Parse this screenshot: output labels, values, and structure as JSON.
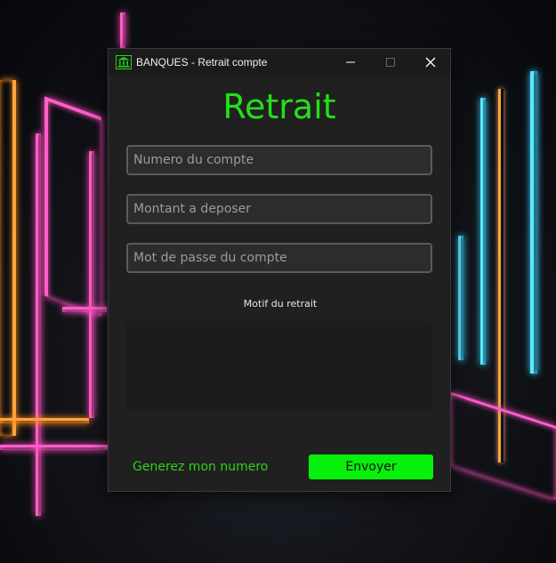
{
  "window": {
    "title": "BANQUES - Retrait compte",
    "icon": "bank-icon"
  },
  "form": {
    "heading": "Retrait",
    "account_number_placeholder": "Numero du compte",
    "amount_placeholder": "Montant a deposer",
    "password_placeholder": "Mot de passe du compte",
    "reason_label": "Motif du retrait",
    "reason_value": "",
    "generate_link": "Generez mon numero",
    "submit_label": "Envoyer"
  },
  "colors": {
    "accent": "#22e01a",
    "button": "#07f00b",
    "window_bg": "#202020"
  }
}
